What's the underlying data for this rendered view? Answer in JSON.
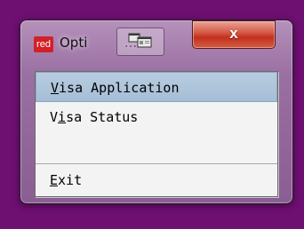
{
  "window": {
    "logo_text": "red",
    "title": "Opti",
    "title_tail": "...",
    "close_symbol": "x"
  },
  "icons": {
    "logo": "app-logo-icon",
    "thumbnail": "window-thumbnail-icon",
    "close": "close-icon"
  },
  "menu": {
    "items": [
      {
        "mnemonic": "V",
        "rest": "isa Application",
        "selected": true
      },
      {
        "prefix": "V",
        "mnemonic": "i",
        "rest": "sa Status",
        "selected": false
      },
      {
        "mnemonic": "E",
        "rest": "xit",
        "selected": false
      }
    ]
  },
  "colors": {
    "desktop": "#6e0f72",
    "selection": "#a9c0d7",
    "close_button": "#c63a25"
  }
}
